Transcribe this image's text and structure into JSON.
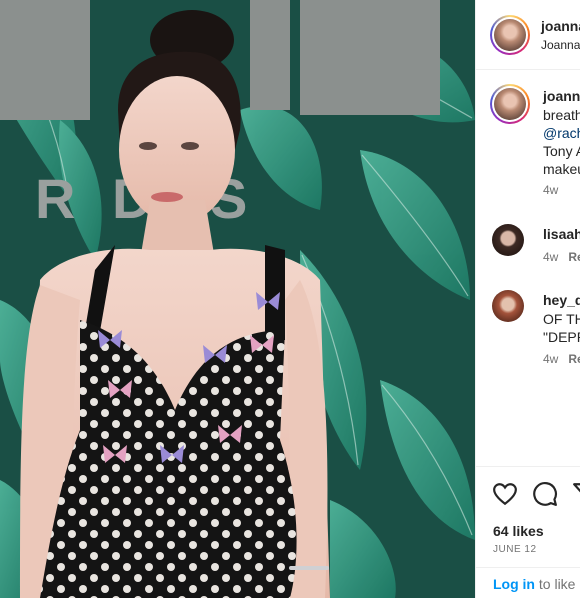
{
  "post": {
    "author": "joanna",
    "author_sub": "Joanna"
  },
  "caption": {
    "username": "joanna",
    "lines": [
      "breath",
      "@rach",
      "Tony A",
      "makeu"
    ],
    "time": "4w"
  },
  "comments": [
    {
      "username": "lisaah",
      "lines": [],
      "time": "4w",
      "reply": "Re"
    },
    {
      "username": "hey_d",
      "lines": [
        "OF TH",
        "\"DEPR"
      ],
      "time": "4w",
      "reply": "Re"
    }
  ],
  "actions": {
    "likes": "64 likes",
    "date": "JUNE 12",
    "login_link": "Log in",
    "login_rest": " to like o"
  },
  "photo": {
    "backdrop_text": "TONY AWARDS"
  },
  "colors": {
    "link": "#00376b",
    "login": "#0095f6",
    "muted": "#737373",
    "backdrop": "#1d5a4e"
  },
  "icons": [
    "heart-icon",
    "comment-icon",
    "share-icon"
  ]
}
